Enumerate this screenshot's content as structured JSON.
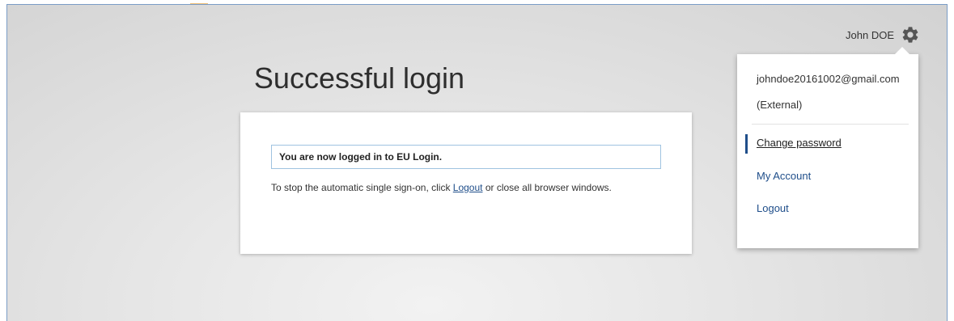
{
  "user": {
    "name": "John DOE",
    "icon": "gear-icon"
  },
  "title": "Successful login",
  "notice": {
    "message": "You are now logged in to EU Login."
  },
  "info": {
    "prefix": "To stop the automatic single sign-on, click ",
    "link": "Logout",
    "suffix": " or close all browser windows."
  },
  "dropdown": {
    "email": "johndoe20161002@gmail.com",
    "account_type": "(External)",
    "items": [
      {
        "label": "Change password"
      },
      {
        "label": "My Account"
      },
      {
        "label": "Logout"
      }
    ]
  },
  "colors": {
    "link": "#1f4e8a",
    "notice_border": "#9fc3e0",
    "frame_border": "#7a9cc6"
  }
}
